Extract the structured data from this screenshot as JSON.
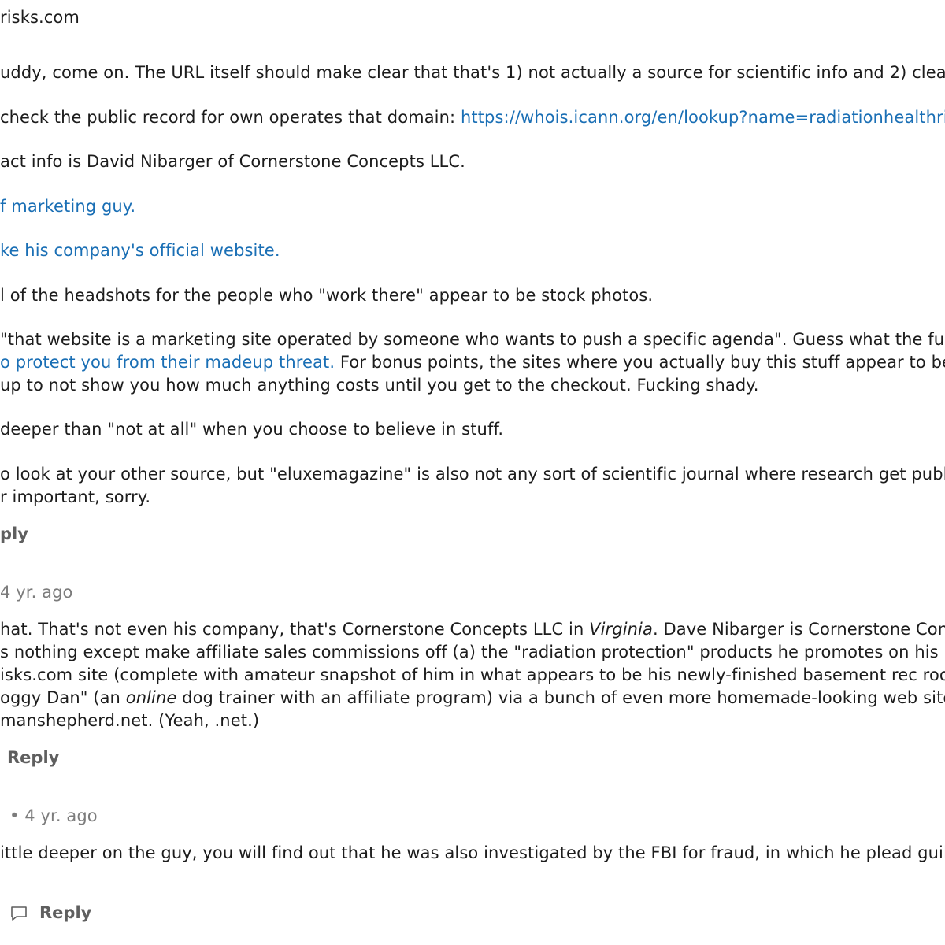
{
  "comment1": {
    "lines": [
      "risks.com",
      "uddy, come on. The URL itself should make clear that that's 1) not actually a source for scientific info and 2) clearly",
      " check the public record for own operates that domain: ",
      "act info is David Nibarger of Cornerstone Concepts LLC.",
      "f marketing guy.",
      "ke his company's official website.",
      "l of the headshots for the people who \"work there\" appear to be stock photos.",
      " \"that website is a marketing site operated by someone who wants to push a specific agenda\". Guess what the fuck",
      "o protect you from their madeup threat.",
      " For bonus points, the sites where you actually buy this stuff appear to be",
      " up to not show you how much anything costs until you get to the checkout. Fucking shady.",
      " deeper than \"not at all\" when you choose to believe in stuff.",
      "o look at your other source, but \"eluxemagazine\" is also not any sort of scientific journal where research get publish",
      "r important, sorry."
    ],
    "whois_link": "https://whois.icann.org/en/lookup?name=radiationhealthri",
    "reply_label": "ply"
  },
  "comment2": {
    "meta": "4 yr. ago",
    "line1a": "hat. That's not even his company, that's Cornerstone Concepts LLC in ",
    "line1_italic": "Virginia",
    "line1b": ". Dave Nibarger is Cornerstone Conce",
    "line2": "s nothing except make affiliate sales commissions off (a) the \"radiation protection\" products he promotes on his h",
    "line3": "isks.com site (complete with amateur snapshot of him in what appears to be his newly-finished basement rec room",
    "line4a": "oggy Dan\" (an ",
    "line4_italic": "online",
    "line4b": " dog trainer with an affiliate program) via a bunch of even more homemade-looking web sites",
    "line5": "manshepherd.net. (Yeah, .net.)",
    "reply_label": "Reply"
  },
  "comment3": {
    "meta": "• 4 yr. ago",
    "line1": "ittle deeper on the guy, you will find out that he was also investigated by the FBI for fraud, in which he plead guilty",
    "reply_label": "Reply"
  }
}
